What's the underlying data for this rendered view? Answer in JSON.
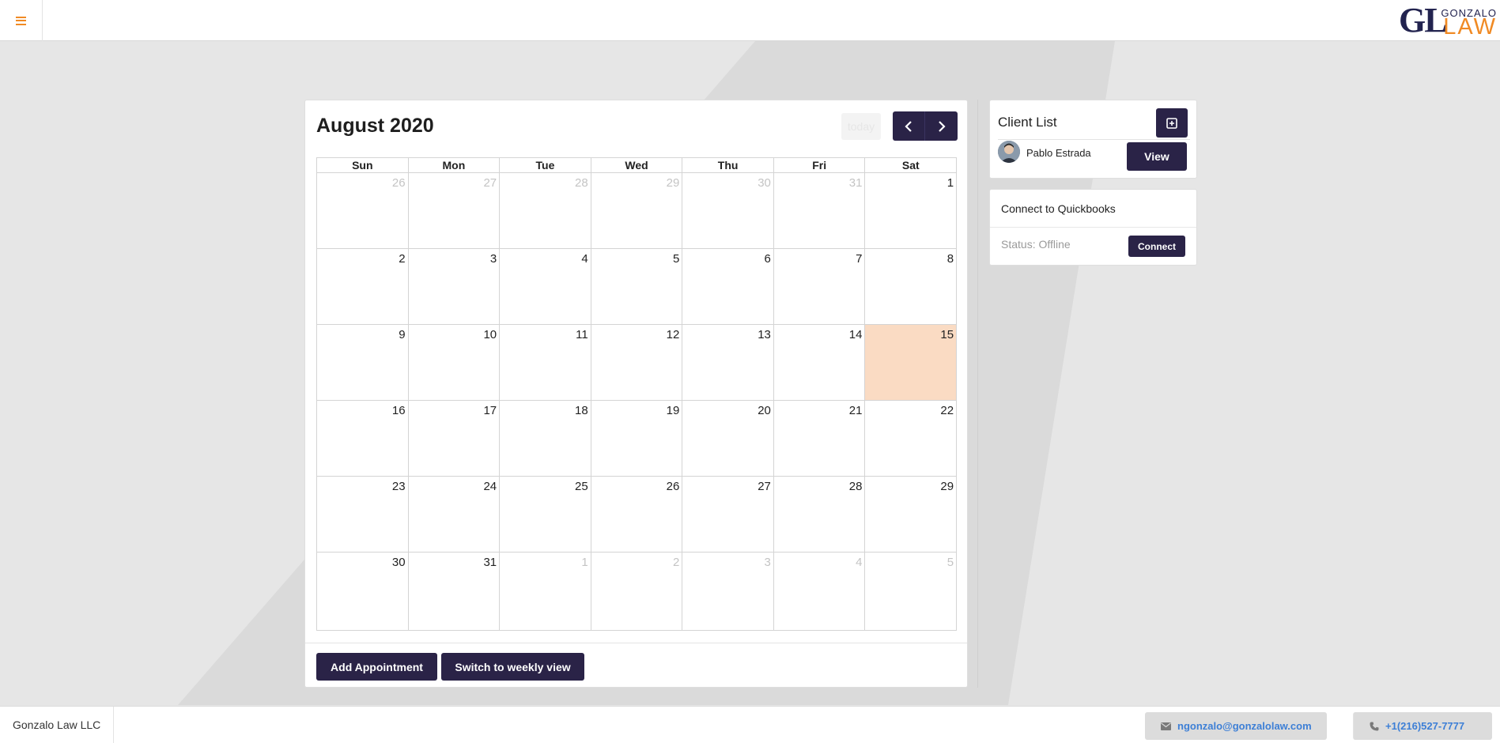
{
  "header": {
    "menu_icon": "hamburger-icon",
    "logo": {
      "mark": "GL",
      "top": "GONZALO",
      "bottom": "LAW"
    },
    "colors": {
      "accent": "#f08a24",
      "brand": "#22234f"
    }
  },
  "calendar": {
    "title": "August 2020",
    "today_label": "today",
    "prev_icon": "chevron-left-icon",
    "next_icon": "chevron-right-icon",
    "weekdays": [
      "Sun",
      "Mon",
      "Tue",
      "Wed",
      "Thu",
      "Fri",
      "Sat"
    ],
    "weeks": [
      [
        {
          "d": "26",
          "o": true
        },
        {
          "d": "27",
          "o": true
        },
        {
          "d": "28",
          "o": true
        },
        {
          "d": "29",
          "o": true
        },
        {
          "d": "30",
          "o": true
        },
        {
          "d": "31",
          "o": true
        },
        {
          "d": "1"
        }
      ],
      [
        {
          "d": "2"
        },
        {
          "d": "3"
        },
        {
          "d": "4"
        },
        {
          "d": "5"
        },
        {
          "d": "6"
        },
        {
          "d": "7"
        },
        {
          "d": "8"
        }
      ],
      [
        {
          "d": "9"
        },
        {
          "d": "10"
        },
        {
          "d": "11"
        },
        {
          "d": "12"
        },
        {
          "d": "13"
        },
        {
          "d": "14"
        },
        {
          "d": "15",
          "today": true
        }
      ],
      [
        {
          "d": "16"
        },
        {
          "d": "17"
        },
        {
          "d": "18"
        },
        {
          "d": "19"
        },
        {
          "d": "20"
        },
        {
          "d": "21"
        },
        {
          "d": "22"
        }
      ],
      [
        {
          "d": "23"
        },
        {
          "d": "24"
        },
        {
          "d": "25"
        },
        {
          "d": "26"
        },
        {
          "d": "27"
        },
        {
          "d": "28"
        },
        {
          "d": "29"
        }
      ],
      [
        {
          "d": "30"
        },
        {
          "d": "31"
        },
        {
          "d": "1",
          "o": true
        },
        {
          "d": "2",
          "o": true
        },
        {
          "d": "3",
          "o": true
        },
        {
          "d": "4",
          "o": true
        },
        {
          "d": "5",
          "o": true
        }
      ]
    ],
    "today_color": "#fadbc3",
    "add_appointment_label": "Add Appointment",
    "weekly_view_label": "Switch to weekly view"
  },
  "client_list": {
    "title": "Client List",
    "add_icon": "plus-square-icon",
    "clients": [
      {
        "name": "Pablo Estrada",
        "action": "View"
      }
    ]
  },
  "quickbooks": {
    "title": "Connect to Quickbooks",
    "status": "Status: Offline",
    "connect_label": "Connect"
  },
  "footer": {
    "company": "Gonzalo Law LLC",
    "email": "ngonzalo@gonzalolaw.com",
    "phone": "+1(216)527-7777",
    "email_icon": "envelope-icon",
    "phone_icon": "phone-icon"
  },
  "theme": {
    "dark_button": "#2a2347",
    "link": "#3d7fd6"
  }
}
